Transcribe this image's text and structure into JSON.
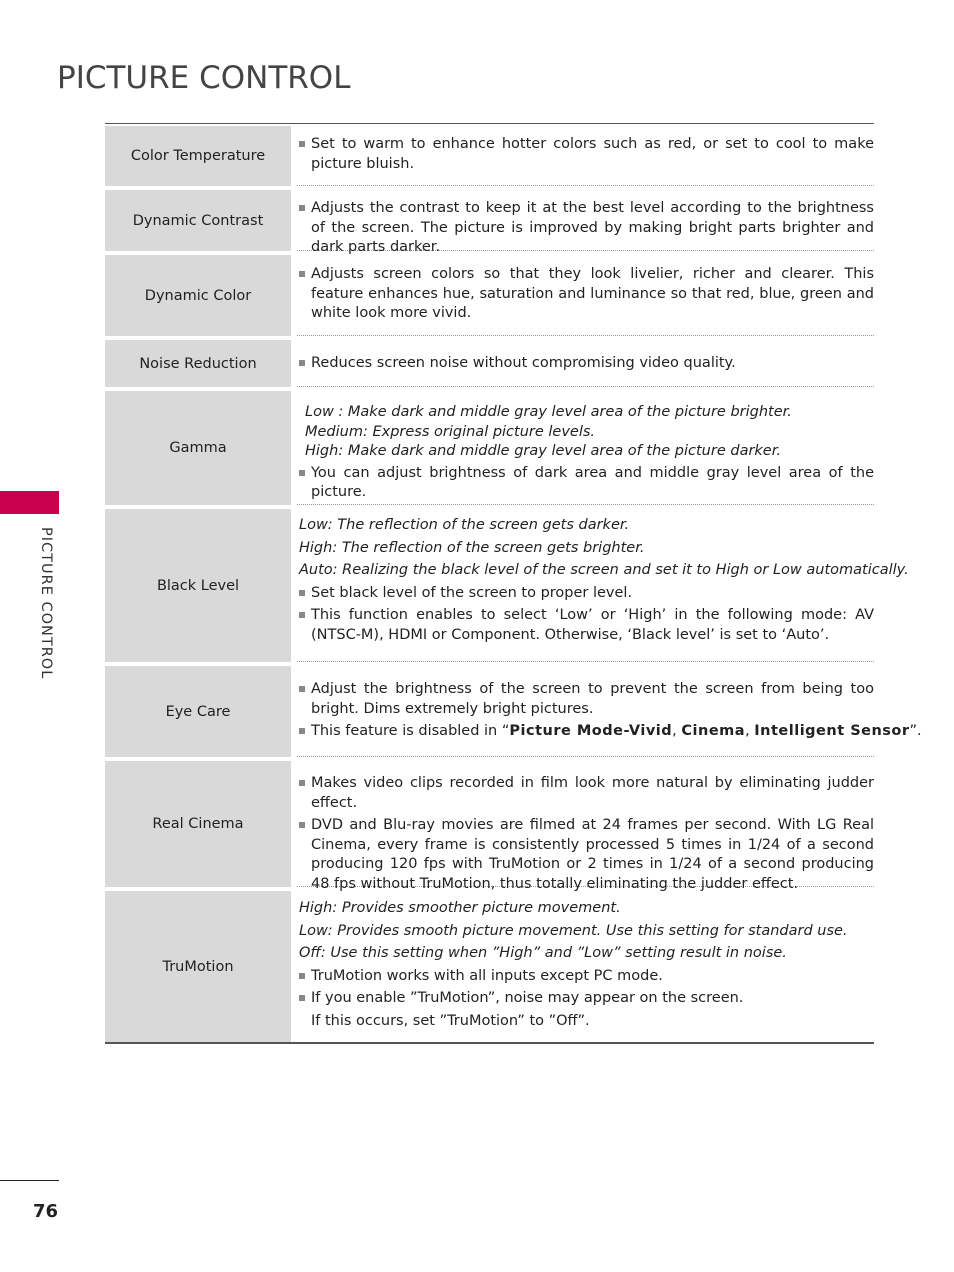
{
  "page": {
    "title": "PICTURE CONTROL",
    "side_label": "PICTURE CONTROL",
    "page_number": "76",
    "accent_color": "#c8004e"
  },
  "rows": [
    {
      "label": "Color Temperature",
      "lines": [
        {
          "type": "bullet",
          "text": "Set to warm to enhance hotter colors such as red, or set to cool to make picture bluish."
        }
      ]
    },
    {
      "label": "Dynamic Contrast",
      "lines": [
        {
          "type": "bullet",
          "text": "Adjusts the contrast to keep it at the best level according to the brightness of the screen. The picture is improved by making bright parts brighter and dark parts darker."
        }
      ]
    },
    {
      "label": "Dynamic Color",
      "lines": [
        {
          "type": "bullet",
          "text": "Adjusts screen colors so that they look livelier, richer and clearer. This feature enhances hue, saturation and luminance so that red, blue, green and white look more vivid."
        }
      ]
    },
    {
      "label": "Noise Reduction",
      "lines": [
        {
          "type": "bullet",
          "text": "Reduces screen noise without compromising video quality."
        }
      ]
    },
    {
      "label": "Gamma",
      "lines": [
        {
          "type": "italic",
          "text": "Low : Make dark and middle gray level area of the picture brighter."
        },
        {
          "type": "italic",
          "text": "Medium: Express original picture levels."
        },
        {
          "type": "italic",
          "text": "High: Make dark and middle gray level area of the picture darker."
        },
        {
          "type": "bullet",
          "text": "You can adjust brightness of dark area and middle gray level area of the picture."
        }
      ]
    },
    {
      "label": "Black Level",
      "lines": [
        {
          "type": "italic",
          "text": "Low: The reflection of the screen gets darker."
        },
        {
          "type": "italic",
          "text": "High: The reflection of the screen gets brighter."
        },
        {
          "type": "italic",
          "text": "Auto: Realizing the black level of the screen and set it to High or Low automatically."
        },
        {
          "type": "bullet",
          "text": "Set black level of the screen to proper level."
        },
        {
          "type": "bullet",
          "text": "This function enables to select ‘Low’ or ‘High’ in the following mode: AV (NTSC-M), HDMI or Component. Otherwise, ‘Black level’ is set to ‘Auto’."
        }
      ]
    },
    {
      "label": "Eye Care",
      "lines": [
        {
          "type": "bullet",
          "text": "Adjust the brightness of the screen to prevent the screen from being too bright. Dims extremely bright pictures."
        }
      ],
      "disabled_note": {
        "prefix": "This feature is disabled in “",
        "mode1": "Picture Mode-Vivid",
        "sep1": ", ",
        "mode2": "Cinema",
        "sep2": ", ",
        "mode3": "Intelligent Sensor",
        "suffix": "”."
      }
    },
    {
      "label": "Real Cinema",
      "lines": [
        {
          "type": "bullet",
          "text": "Makes video clips recorded in film look more natural by eliminating judder effect."
        },
        {
          "type": "bullet",
          "text": "DVD and Blu-ray movies are filmed at 24 frames per second. With LG Real Cinema, every frame is consistently processed 5 times in 1/24 of a second producing 120 fps with TruMotion or 2 times in 1/24 of a second producing 48 fps without TruMotion, thus totally eliminating the judder effect."
        }
      ]
    },
    {
      "label": "TruMotion",
      "lines": [
        {
          "type": "italic",
          "text": "High: Provides smoother picture movement."
        },
        {
          "type": "italic",
          "text": "Low: Provides smooth picture movement. Use this setting for standard use."
        },
        {
          "type": "italic",
          "text": "Off: Use this setting when ”High” and ”Low” setting result in noise."
        },
        {
          "type": "bullet",
          "text": "TruMotion works with all inputs except PC mode."
        },
        {
          "type": "bullet",
          "text": "If you enable ”TruMotion”, noise may appear on the screen."
        },
        {
          "type": "plain",
          "text": "If this occurs, set ”TruMotion” to ”Off”."
        }
      ]
    }
  ]
}
